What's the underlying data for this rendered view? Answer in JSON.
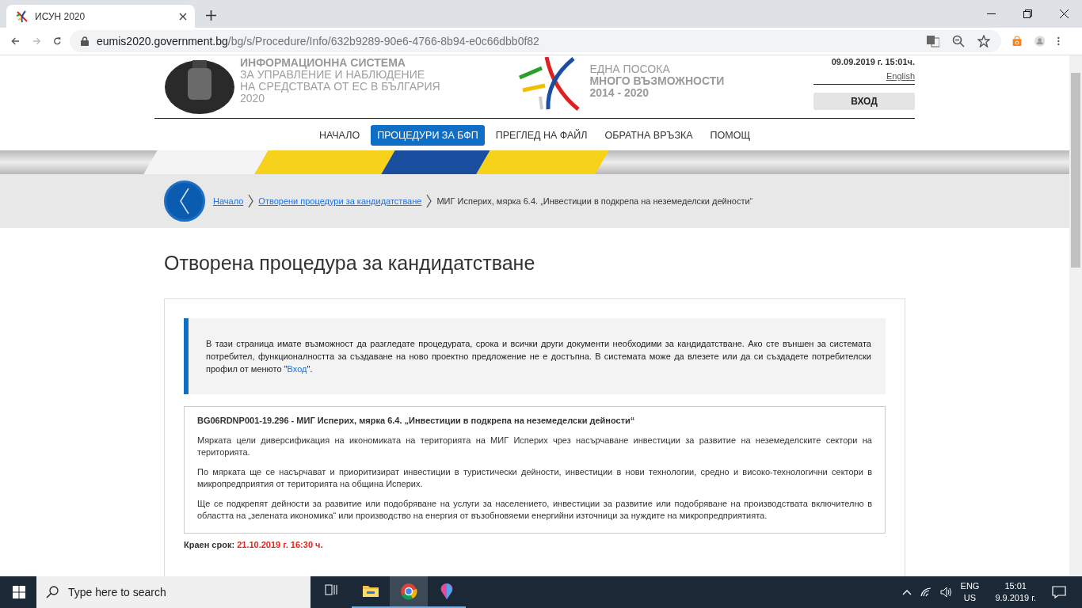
{
  "browser": {
    "tab": {
      "title": "ИСУН 2020"
    },
    "url": {
      "domain": "eumis2020.government.bg",
      "path": "/bg/s/Procedure/Info/632b9289-90e6-4766-8b94-e0c66dbb0f82"
    }
  },
  "header": {
    "system_name": [
      "ИНФОРМАЦИОННА СИСТЕМА",
      "ЗА УПРАВЛЕНИЕ И НАБЛЮДЕНИЕ",
      "НА СРЕДСТВАТА ОТ ЕС В БЪЛГАРИЯ",
      "2020"
    ],
    "slogan": [
      "ЕДНА ПОСОКА",
      "МНОГО ВЪЗМОЖНОСТИ",
      "2014 - 2020"
    ],
    "datetime": "09.09.2019 г. 15:01ч.",
    "language_link": "English",
    "login_button": "ВХОД"
  },
  "nav": [
    {
      "label": "НАЧАЛО",
      "selected": false
    },
    {
      "label": "ПРОЦЕДУРИ ЗА БФП",
      "selected": true
    },
    {
      "label": "ПРЕГЛЕД НА ФАЙЛ",
      "selected": false
    },
    {
      "label": "ОБРАТНА ВРЪЗКА",
      "selected": false
    },
    {
      "label": "ПОМОЩ",
      "selected": false
    }
  ],
  "breadcrumb": [
    {
      "label": "Начало",
      "kind": "link"
    },
    {
      "label": "Отворени процедури за кандидатстване",
      "kind": "link"
    },
    {
      "label": "МИГ Исперих, мярка 6.4. „Инвестиции в подкрепа на неземеделски дейности“",
      "kind": "current"
    }
  ],
  "page_title": "Отворена процедура за кандидатстване",
  "notice": {
    "text": "В тази страница имате възможност да разгледате процедурата, срока и всички други документи необходими за кандидатстване. Ако сте външен за системата потребител, функционалността за създаване на ново проектно предложение не е достъпна. В системата може да влезете или да си създадете потребителски профил от менюто \"",
    "link": "Вход",
    "text_after": "\"."
  },
  "procedure": {
    "title": "BG06RDNP001-19.296 - МИГ Исперих, мярка 6.4. „Инвестиции в подкрепа на неземеделски дейности“",
    "paragraphs": [
      "Мярката цели диверсификация на икономиката на територията на МИГ Исперих чрез насърчаване инвестиции за развитие на неземеделските сектори на територията.",
      "По мярката ще се насърчават и приоритизират инвестиции в туристически дейности, инвестиции в нови технологии, средно и високо-технологични сектори в микропредприятия от територията на община Исперих.",
      "Ще се подкрепят дейности за развитие или подобряване на услуги за населението, инвестиции за развитие или подобряване на производствата включително в областта на „зелената икономика“ или производство на енергия от възобновяеми енергийни източници за нуждите на микропредприятията."
    ]
  },
  "deadline": {
    "label": "Краен срок:",
    "value": "21.10.2019 г. 16:30 ч."
  },
  "taskbar": {
    "search_placeholder": "Type here to search",
    "apps": [
      {
        "kind": "taskview",
        "selected": false
      },
      {
        "kind": "explorer",
        "selected": false
      },
      {
        "kind": "chrome",
        "selected": true
      },
      {
        "kind": "paint",
        "selected": false
      }
    ],
    "language": [
      "ENG",
      "US"
    ],
    "time": "15:01",
    "date": "9.9.2019 г."
  }
}
